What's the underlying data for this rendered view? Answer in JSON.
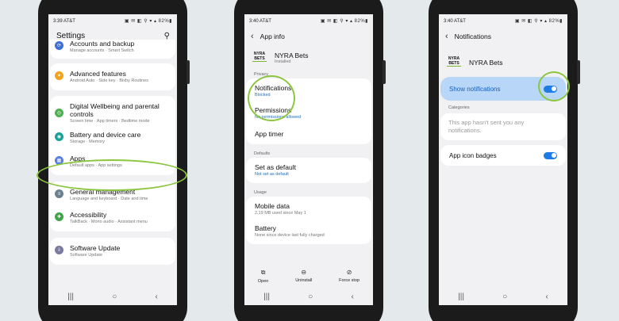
{
  "phone1": {
    "status": {
      "time": "3:39 AT&T",
      "icons": "▣ ✉ ◧ ⚲ ▾ ▴ 82%▮"
    },
    "title": "Settings",
    "items": [
      {
        "title": "Accounts and backup",
        "sub": "Manage accounts · Smart Switch",
        "color": "#3c6fd8",
        "icon": "⟳"
      },
      {
        "title": "Advanced features",
        "sub": "Android Auto · Side key · Bixby Routines",
        "color": "#f2a21b",
        "icon": "✦"
      },
      {
        "title": "Digital Wellbeing and parental controls",
        "sub": "Screen time · App timers · Bedtime mode",
        "color": "#4cb050",
        "icon": "◎"
      },
      {
        "title": "Battery and device care",
        "sub": "Storage · Memory",
        "color": "#18a199",
        "icon": "◉"
      },
      {
        "title": "Apps",
        "sub": "Default apps · App settings",
        "color": "#5a7fe0",
        "icon": "▦"
      },
      {
        "title": "General management",
        "sub": "Language and keyboard · Date and time",
        "color": "#6b7f8e",
        "icon": "≡"
      },
      {
        "title": "Accessibility",
        "sub": "TalkBack · Mono audio · Assistant menu",
        "color": "#3ba645",
        "icon": "✚"
      },
      {
        "title": "Software Update",
        "sub": "Software Update",
        "color": "#7a7aa0",
        "icon": "⇩"
      }
    ]
  },
  "phone2": {
    "status": {
      "time": "3:40 AT&T",
      "icons": "▣ ✉ ◧ ⚲ ▾ ▴ 82%▮"
    },
    "header": "App info",
    "app_name": "NYRA Bets",
    "installed": "Installed",
    "logo_top": "NYRA",
    "logo_bottom": "BETS",
    "section_privacy": "Privacy",
    "notifications_title": "Notifications",
    "notifications_sub": "Blocked",
    "permissions_title": "Permissions",
    "permissions_sub": "No permissions allowed",
    "app_timer": "App timer",
    "section_defaults": "Defaults",
    "default_title": "Set as default",
    "default_sub": "Not set as default",
    "section_usage": "Usage",
    "mobile_title": "Mobile data",
    "mobile_sub": "2.19 MB used since May 1",
    "battery_title": "Battery",
    "battery_sub": "None since device last fully charged",
    "actions": [
      "Open",
      "Uninstall",
      "Force stop"
    ]
  },
  "phone3": {
    "status": {
      "time": "3:40 AT&T",
      "icons": "▣ ✉ ◧ ⚲ ▾ ▴ 82%▮"
    },
    "header": "Notifications",
    "app_name": "NYRA Bets",
    "show_label": "Show notifications",
    "categories_label": "Categories",
    "categories_text": "This app hasn't sent you any notifications.",
    "badges_label": "App icon badges"
  },
  "nav": {
    "recents": "|||",
    "home": "○",
    "back": "‹"
  },
  "colors": {
    "highlight": "#8cc63f",
    "toggle": "#1f7be5",
    "link": "#1c6fc5"
  }
}
